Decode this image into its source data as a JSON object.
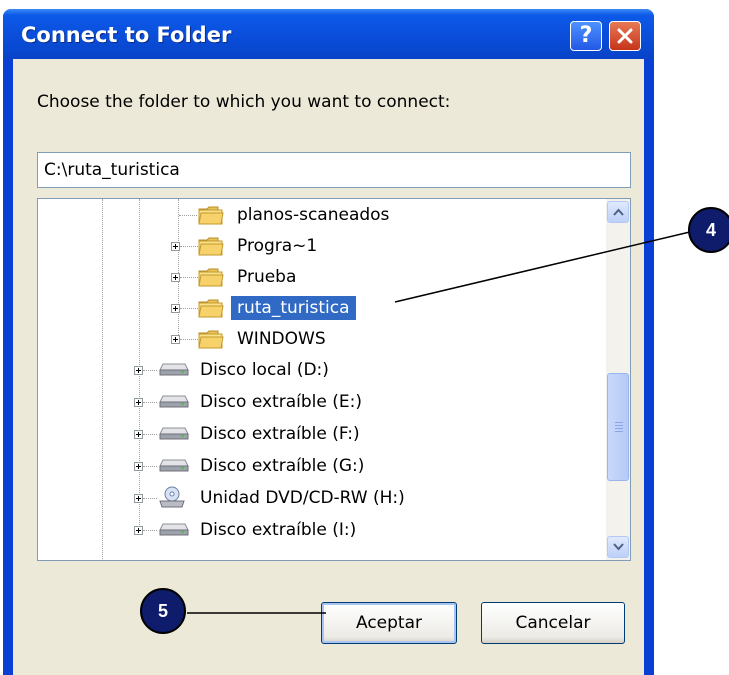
{
  "window": {
    "title": "Connect to Folder",
    "help_label": "?"
  },
  "prompt": "Choose the folder to which you want to connect:",
  "path_value": "C:\\ruta_turistica",
  "tree": {
    "folders": [
      {
        "label": "planos-scaneados",
        "expandable": false,
        "selected": false
      },
      {
        "label": "Progra~1",
        "expandable": true,
        "selected": false
      },
      {
        "label": "Prueba",
        "expandable": true,
        "selected": false
      },
      {
        "label": "ruta_turistica",
        "expandable": true,
        "selected": true
      },
      {
        "label": "WINDOWS",
        "expandable": true,
        "selected": false
      }
    ],
    "drives": [
      {
        "label": "Disco local (D:)",
        "icon": "hard-drive-icon"
      },
      {
        "label": "Disco extraíble (E:)",
        "icon": "removable-drive-icon"
      },
      {
        "label": "Disco extraíble (F:)",
        "icon": "removable-drive-icon"
      },
      {
        "label": "Disco extraíble (G:)",
        "icon": "removable-drive-icon"
      },
      {
        "label": "Unidad DVD/CD-RW (H:)",
        "icon": "dvd-drive-icon"
      },
      {
        "label": "Disco extraíble (I:)",
        "icon": "removable-drive-icon"
      }
    ]
  },
  "buttons": {
    "ok": "Aceptar",
    "cancel": "Cancelar"
  },
  "callouts": {
    "folder": "4",
    "ok": "5"
  },
  "colors": {
    "title_bar": "#0a4fdc",
    "selection": "#316ac5",
    "callout": "#0f1b6b"
  }
}
